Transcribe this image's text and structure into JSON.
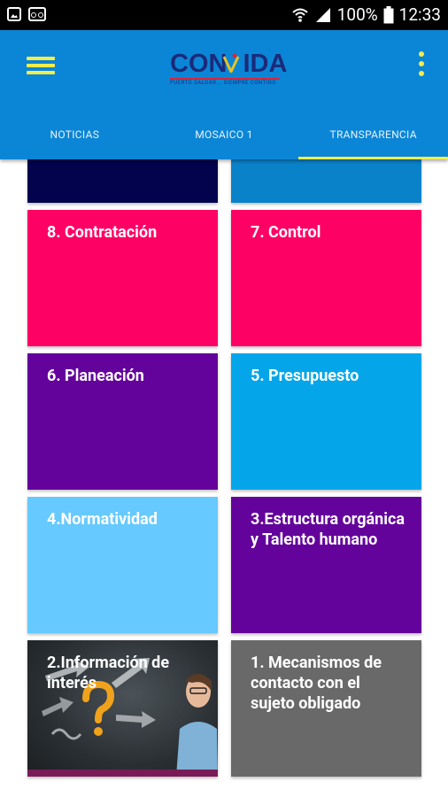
{
  "status_bar": {
    "battery_percent": "100%",
    "time": "12:33",
    "left_icons": [
      "image-notification-icon",
      "voicemail-icon"
    ],
    "right_icons": [
      "wifi-icon",
      "signal-icon",
      "battery-icon"
    ]
  },
  "app_bar": {
    "logo": {
      "text_before": "CON",
      "text_after": "IDA",
      "tagline": "PUERTO SALGAR... SIEMPRE CONTIGO"
    },
    "tabs": [
      {
        "label": "NOTICIAS",
        "active": false
      },
      {
        "label": "MOSAICO 1",
        "active": false
      },
      {
        "label": "TRANSPARENCIA",
        "active": true
      }
    ],
    "colors": {
      "background": "#0b86d6",
      "accent": "#f6ec4a"
    }
  },
  "tiles": [
    {
      "label": "",
      "color": "#02024d"
    },
    {
      "label": "",
      "color": "#0a82c9"
    },
    {
      "label": "8. Contratación",
      "color": "#fe0165"
    },
    {
      "label": "7. Control",
      "color": "#fe0165"
    },
    {
      "label": "6. Planeación",
      "color": "#64039b"
    },
    {
      "label": "5. Presupuesto",
      "color": "#04a6e9"
    },
    {
      "label": "4.Normatividad",
      "color": "#66c9ff"
    },
    {
      "label": "3.Estructura orgánica y Talento humano",
      "color": "#64039b"
    },
    {
      "label": "2.Información de interés",
      "color": "#2b2f33"
    },
    {
      "label": "1. Mecanismos de contacto con el sujeto obligado",
      "color": "#696969"
    }
  ]
}
